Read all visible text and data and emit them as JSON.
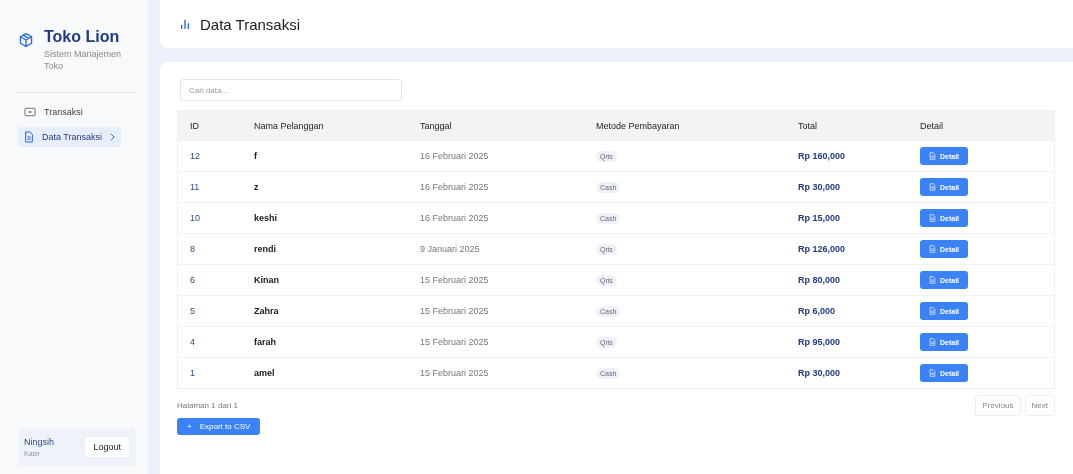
{
  "brand": {
    "name": "Toko Lion",
    "subtitle": "Sistem Manajemen Toko"
  },
  "sidebar": {
    "items": [
      {
        "label": "Transaksi",
        "selected": false
      },
      {
        "label": "Data Transaksi",
        "selected": true
      }
    ]
  },
  "user": {
    "name": "Ningsih",
    "role": "Kasir",
    "logout": "Logout"
  },
  "header": {
    "title": "Data Transaksi"
  },
  "search": {
    "placeholder": "Cari data..."
  },
  "table": {
    "columns": [
      "ID",
      "Nama Pelanggan",
      "Tanggal",
      "Metode Pembayaran",
      "Total",
      "Detail"
    ],
    "rows": [
      {
        "id": "12",
        "name": "f",
        "date": "16 Februari 2025",
        "method": "Qris",
        "total": "Rp 160,000",
        "action": "Detail"
      },
      {
        "id": "11",
        "name": "z",
        "date": "16 Februari 2025",
        "method": "Cash",
        "total": "Rp 30,000",
        "action": "Detail"
      },
      {
        "id": "10",
        "name": "keshi",
        "date": "16 Februari 2025",
        "method": "Cash",
        "total": "Rp 15,000",
        "action": "Detail"
      },
      {
        "id": "8",
        "name": "rendi",
        "date": "9 Januari 2025",
        "method": "Qris",
        "total": "Rp 126,000",
        "action": "Detail"
      },
      {
        "id": "6",
        "name": "Kinan",
        "date": "15 Februari 2025",
        "method": "Qris",
        "total": "Rp 80,000",
        "action": "Detail"
      },
      {
        "id": "5",
        "name": "Zahra",
        "date": "15 Februari 2025",
        "method": "Cash",
        "total": "Rp 6,000",
        "action": "Detail"
      },
      {
        "id": "4",
        "name": "farah",
        "date": "15 Februari 2025",
        "method": "Qris",
        "total": "Rp 95,000",
        "action": "Detail"
      },
      {
        "id": "1",
        "name": "amel",
        "date": "15 Februari 2025",
        "method": "Cash",
        "total": "Rp 30,000",
        "action": "Detail"
      }
    ]
  },
  "pagination": {
    "info": "Halaman 1 dari 1",
    "previous": "Previous",
    "next": "Next"
  },
  "export_button": {
    "label": "Export to CSV",
    "icon": "+"
  }
}
